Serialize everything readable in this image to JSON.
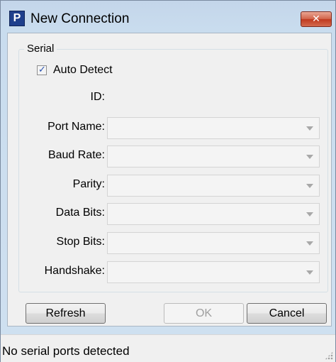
{
  "window": {
    "title": "New Connection",
    "app_icon_letter": "P",
    "close_glyph": "✕"
  },
  "serial_group": {
    "legend": "Serial",
    "auto_detect": {
      "label": "Auto Detect",
      "checked": true
    },
    "id_label": "ID:",
    "fields": [
      {
        "label": "Port Name:",
        "value": ""
      },
      {
        "label": "Baud Rate:",
        "value": ""
      },
      {
        "label": "Parity:",
        "value": ""
      },
      {
        "label": "Data Bits:",
        "value": ""
      },
      {
        "label": "Stop Bits:",
        "value": ""
      },
      {
        "label": "Handshake:",
        "value": ""
      }
    ]
  },
  "buttons": {
    "refresh": "Refresh",
    "ok": "OK",
    "cancel": "Cancel"
  },
  "status": {
    "text": "No serial ports detected"
  }
}
